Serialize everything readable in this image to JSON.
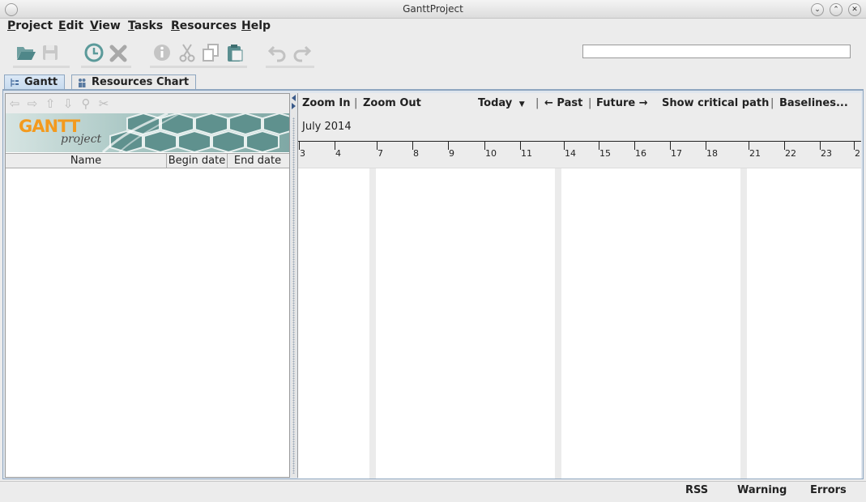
{
  "window": {
    "title": "GanttProject"
  },
  "menu": [
    "Project",
    "Edit",
    "View",
    "Tasks",
    "Resources",
    "Help"
  ],
  "toolbar": {
    "icons": [
      "open-folder-icon",
      "save-icon",
      "clock-icon",
      "delete-icon",
      "info-icon",
      "cut-icon",
      "copy-icon",
      "paste-icon",
      "undo-icon",
      "redo-icon"
    ],
    "search": {
      "value": "",
      "placeholder": ""
    }
  },
  "tabs": [
    {
      "label": "Gantt",
      "active": true
    },
    {
      "label": "Resources Chart",
      "active": false
    }
  ],
  "tree": {
    "logo_text": "GANTT",
    "logo_subtext": "project",
    "columns": [
      "Name",
      "Begin date",
      "End date"
    ],
    "rows": []
  },
  "chart_toolbar": {
    "zoom_in": "Zoom In",
    "zoom_out": "Zoom Out",
    "today": "Today",
    "past": "← Past",
    "future": "Future →",
    "critical_path": "Show critical path",
    "baselines": "Baselines..."
  },
  "timeline": {
    "month": "July 2014",
    "days": [
      "3",
      "4",
      "7",
      "8",
      "9",
      "10",
      "11",
      "14",
      "15",
      "16",
      "17",
      "18",
      "21",
      "22",
      "23",
      "2"
    ]
  },
  "status": {
    "rss": "RSS",
    "warning": "Warning",
    "errors": "Errors"
  },
  "colors": {
    "accent": "#5b9a9a",
    "tab_active": "#c6daee",
    "logo_orange": "#f39a1e"
  }
}
